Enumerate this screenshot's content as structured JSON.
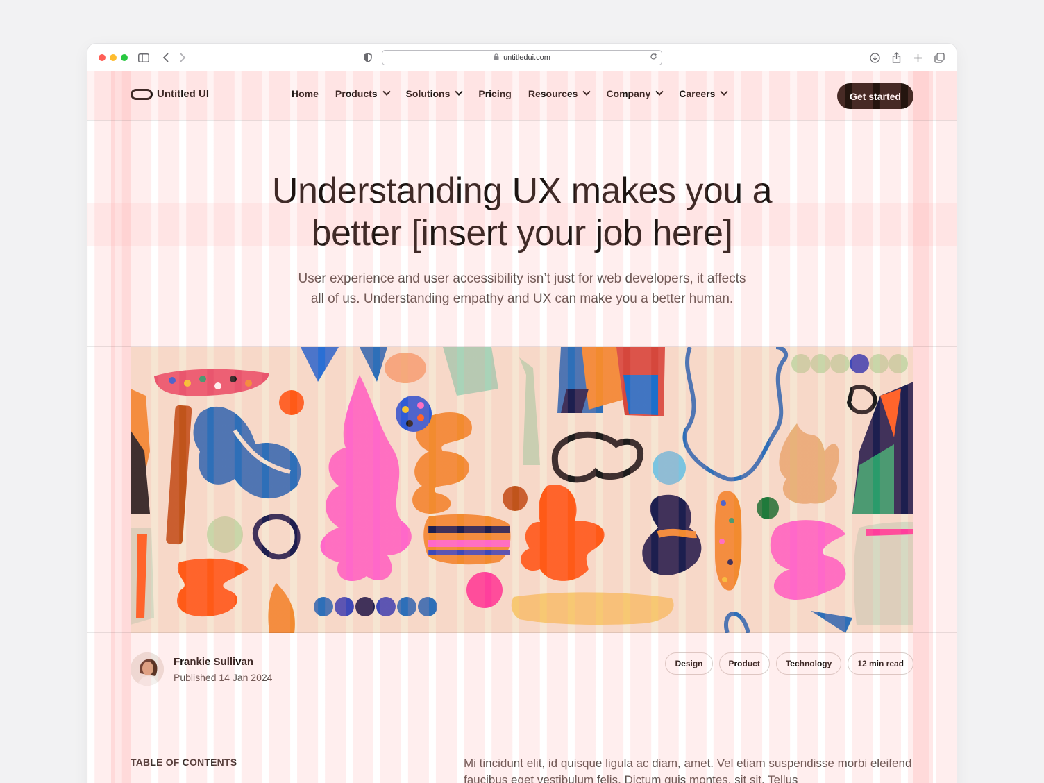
{
  "browser": {
    "url": "untitledui.com",
    "traffic_lights": [
      "#ff5f57",
      "#febc2e",
      "#28c840"
    ]
  },
  "nav": {
    "brand": "Untitled UI",
    "items": [
      {
        "label": "Home",
        "dropdown": false
      },
      {
        "label": "Products",
        "dropdown": true
      },
      {
        "label": "Solutions",
        "dropdown": true
      },
      {
        "label": "Pricing",
        "dropdown": false
      },
      {
        "label": "Resources",
        "dropdown": true
      },
      {
        "label": "Company",
        "dropdown": true
      },
      {
        "label": "Careers",
        "dropdown": true
      }
    ],
    "cta": "Get started"
  },
  "hero": {
    "title_line1": "Understanding UX makes you a",
    "title_line2": "better [insert your job here]",
    "subtitle_line1": "User experience and user accessibility isn’t just for web developers, it affects",
    "subtitle_line2": "all of us. Understanding empathy and UX can make you a better human."
  },
  "author": {
    "name": "Frankie Sullivan",
    "published": "Published 14 Jan 2024"
  },
  "tags": [
    "Design",
    "Product",
    "Technology",
    "12 min read"
  ],
  "toc_heading": "TABLE OF CONTENTS",
  "body_text": "Mi tincidunt elit, id quisque ligula ac diam, amet. Vel etiam suspendisse morbi eleifend faucibus eget vestibulum felis. Dictum quis montes, sit sit. Tellus",
  "colors": {
    "accent_dark": "#24150f",
    "grid_overlay": "#ffa0a0",
    "art_background": "#f6e5d2"
  }
}
